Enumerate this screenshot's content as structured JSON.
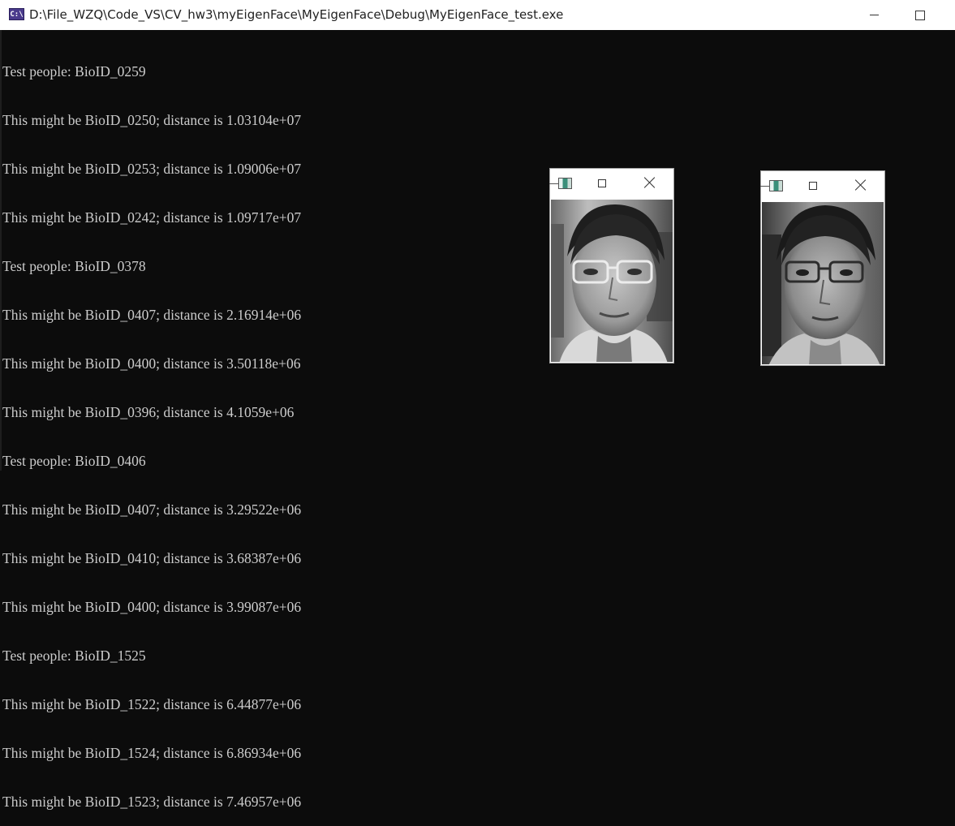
{
  "window": {
    "icon_text": "C:\\",
    "title": "D:\\File_WZQ\\Code_VS\\CV_hw3\\myEigenFace\\MyEigenFace\\Debug\\MyEigenFace_test.exe"
  },
  "console": {
    "lines": [
      "Test people: BioID_0259",
      "This might be BioID_0250; distance is 1.03104e+07",
      "This might be BioID_0253; distance is 1.09006e+07",
      "This might be BioID_0242; distance is 1.09717e+07",
      "Test people: BioID_0378",
      "This might be BioID_0407; distance is 2.16914e+06",
      "This might be BioID_0400; distance is 3.50118e+06",
      "This might be BioID_0396; distance is 4.1059e+06",
      "Test people: BioID_0406",
      "This might be BioID_0407; distance is 3.29522e+06",
      "This might be BioID_0410; distance is 3.68387e+06",
      "This might be BioID_0400; distance is 3.99087e+06",
      "Test people: BioID_1525",
      "This might be BioID_1522; distance is 6.44877e+06",
      "This might be BioID_1524; distance is 6.86934e+06",
      "This might be BioID_1523; distance is 7.46957e+06"
    ]
  },
  "image_windows": [
    {
      "icon": "image-window-icon",
      "content": "grayscale face photo"
    },
    {
      "icon": "image-window-icon",
      "content": "grayscale face photo"
    }
  ],
  "colors": {
    "console_bg": "#0c0c0c",
    "console_text": "#cccccc",
    "titlebar_bg": "#ffffff"
  }
}
